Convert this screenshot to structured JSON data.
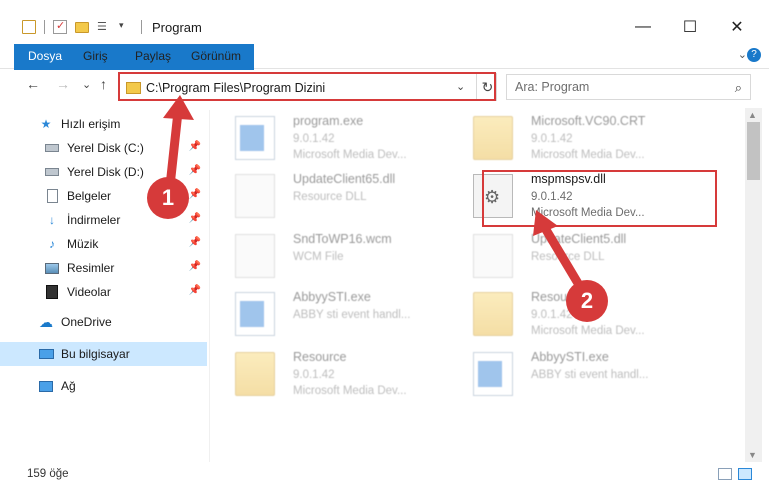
{
  "window": {
    "title": "Program",
    "minimize": "—",
    "maximize": "☐",
    "close": "✕"
  },
  "ribbon": {
    "tabs": [
      "Dosya",
      "Giriş",
      "Paylaş",
      "Görünüm"
    ],
    "help": "?"
  },
  "nav": {
    "back": "←",
    "forward": "→",
    "recent": "⌄",
    "up": "↑",
    "address": "C:\\Program Files\\Program Dizini",
    "refresh": "↻",
    "search_placeholder": "Ara: Program",
    "search_icon": "⌕"
  },
  "sidebar": {
    "items": [
      {
        "label": "Hızlı erişim",
        "icon": "star-icon",
        "pinned": false
      },
      {
        "label": "Yerel Disk (C:)",
        "icon": "drive-icon",
        "pinned": true
      },
      {
        "label": "Yerel Disk (D:)",
        "icon": "drive-icon",
        "pinned": true
      },
      {
        "label": "Belgeler",
        "icon": "documents-icon",
        "pinned": true
      },
      {
        "label": "İndirmeler",
        "icon": "downloads-icon",
        "pinned": true
      },
      {
        "label": "Müzik",
        "icon": "music-icon",
        "pinned": true
      },
      {
        "label": "Resimler",
        "icon": "pictures-icon",
        "pinned": true
      },
      {
        "label": "Videolar",
        "icon": "videos-icon",
        "pinned": true
      },
      {
        "label": "OneDrive",
        "icon": "cloud-icon",
        "pinned": false
      },
      {
        "label": "Bu bilgisayar",
        "icon": "computer-icon",
        "pinned": false,
        "selected": true
      },
      {
        "label": "Ağ",
        "icon": "network-icon",
        "pinned": false
      }
    ]
  },
  "files": [
    {
      "name": "program.exe",
      "l1": "9.0.1.42",
      "l2": "Microsoft Media Dev...",
      "icon": "exe-icon",
      "faded": true
    },
    {
      "name": "Microsoft.VC90.CRT",
      "l1": "9.0.1.42",
      "l2": "Microsoft Media Dev...",
      "icon": "folder-icon",
      "faded": true
    },
    {
      "name": "UpdateClient65.dll",
      "l1": "Resource DLL",
      "l2": "",
      "icon": "dll-icon",
      "faded": true
    },
    {
      "name": "mspmspsv.dll",
      "l1": "9.0.1.42",
      "l2": "Microsoft Media Dev...",
      "icon": "dll-icon",
      "faded": false
    },
    {
      "name": "SndToWP16.wcm",
      "l1": "WCM File",
      "l2": "",
      "icon": "doc-icon",
      "faded": true
    },
    {
      "name": "UpdateClient5.dll",
      "l1": "Resource DLL",
      "l2": "",
      "icon": "dll-icon",
      "faded": true
    },
    {
      "name": "AbbyySTI.exe",
      "l1": "ABBY sti event handl...",
      "l2": "",
      "icon": "exe-icon",
      "faded": true
    },
    {
      "name": "Resource",
      "l1": "9.0.1.42",
      "l2": "Microsoft Media Dev...",
      "icon": "folder-icon",
      "faded": true
    },
    {
      "name": "Resource",
      "l1": "9.0.1.42",
      "l2": "Microsoft Media Dev...",
      "icon": "folder-icon",
      "faded": true
    },
    {
      "name": "AbbyySTI.exe",
      "l1": "ABBY sti event handl...",
      "l2": "",
      "icon": "exe-icon",
      "faded": true
    }
  ],
  "status": {
    "count": "159 öğe"
  },
  "annotations": {
    "badge1": "1",
    "badge2": "2",
    "color": "#d63a3a"
  }
}
